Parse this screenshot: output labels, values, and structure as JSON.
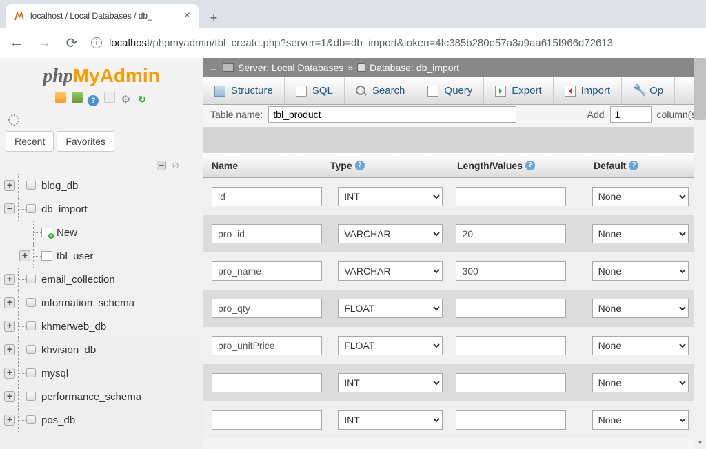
{
  "browser": {
    "tab_title": "localhost / Local Databases / db_",
    "url_prefix": "localhost",
    "url_rest": "/phpmyadmin/tbl_create.php?server=1&db=db_import&token=4fc385b280e57a3a9aa615f966d72613"
  },
  "logo": {
    "php": "php",
    "my": "My",
    "admin": "Admin"
  },
  "sidebar": {
    "recent": "Recent",
    "favorites": "Favorites",
    "tree": [
      {
        "label": "blog_db",
        "level": 0,
        "exp": "+"
      },
      {
        "label": "db_import",
        "level": 0,
        "exp": "−"
      },
      {
        "label": "New",
        "level": 1,
        "exp": ""
      },
      {
        "label": "tbl_user",
        "level": 1,
        "exp": "+"
      },
      {
        "label": "email_collection",
        "level": 0,
        "exp": "+"
      },
      {
        "label": "information_schema",
        "level": 0,
        "exp": "+"
      },
      {
        "label": "khmerweb_db",
        "level": 0,
        "exp": "+"
      },
      {
        "label": "khvision_db",
        "level": 0,
        "exp": "+"
      },
      {
        "label": "mysql",
        "level": 0,
        "exp": "+"
      },
      {
        "label": "performance_schema",
        "level": 0,
        "exp": "+"
      },
      {
        "label": "pos_db",
        "level": 0,
        "exp": "+"
      }
    ]
  },
  "crumb": {
    "server_lbl": "Server: Local Databases",
    "db_lbl": "Database: db_import"
  },
  "toolbar": {
    "structure": "Structure",
    "sql": "SQL",
    "search": "Search",
    "query": "Query",
    "export": "Export",
    "import": "Import",
    "operations": "Op"
  },
  "tablerow": {
    "name_lbl": "Table name:",
    "name_val": "tbl_product",
    "add_lbl": "Add",
    "cols_val": "1",
    "cols_lbl": "column(s)"
  },
  "headers": {
    "name": "Name",
    "type": "Type",
    "length": "Length/Values",
    "default": "Default"
  },
  "rows": [
    {
      "name": "id",
      "type": "INT",
      "len": "",
      "def": "None"
    },
    {
      "name": "pro_id",
      "type": "VARCHAR",
      "len": "20",
      "def": "None"
    },
    {
      "name": "pro_name",
      "type": "VARCHAR",
      "len": "300",
      "def": "None"
    },
    {
      "name": "pro_qty",
      "type": "FLOAT",
      "len": "",
      "def": "None"
    },
    {
      "name": "pro_unitPrice",
      "type": "FLOAT",
      "len": "",
      "def": "None"
    },
    {
      "name": "",
      "type": "INT",
      "len": "",
      "def": "None"
    },
    {
      "name": "",
      "type": "INT",
      "len": "",
      "def": "None"
    }
  ]
}
